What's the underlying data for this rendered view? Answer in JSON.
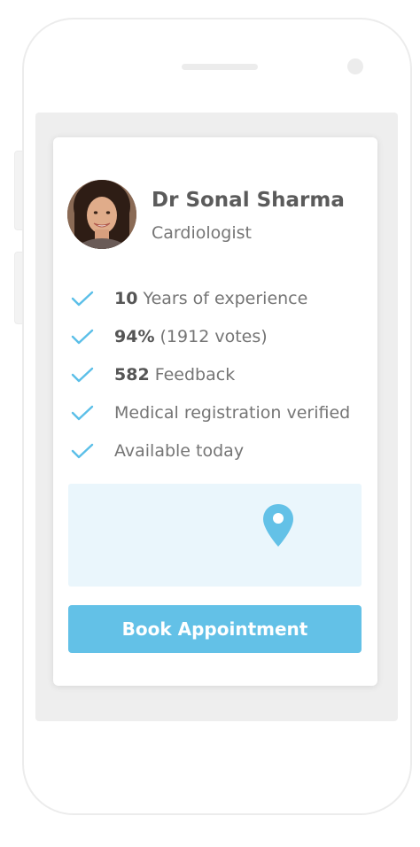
{
  "doctor": {
    "name": "Dr Sonal Sharma",
    "specialty": "Cardiologist"
  },
  "features": [
    {
      "bold": "10",
      "text": " Years of experience"
    },
    {
      "bold": "94%",
      "text": " (1912 votes)"
    },
    {
      "bold": "582",
      "text": " Feedback"
    },
    {
      "bold": "",
      "text": "Medical registration verified"
    },
    {
      "bold": "",
      "text": "Available today"
    }
  ],
  "actions": {
    "book_label": "Book Appointment"
  },
  "icons": {
    "feature_icon": "check-icon",
    "map_icon": "location-pin-icon"
  },
  "colors": {
    "accent": "#63c1e7",
    "check": "#5bbfe8",
    "map_background": "#eaf6fc"
  }
}
